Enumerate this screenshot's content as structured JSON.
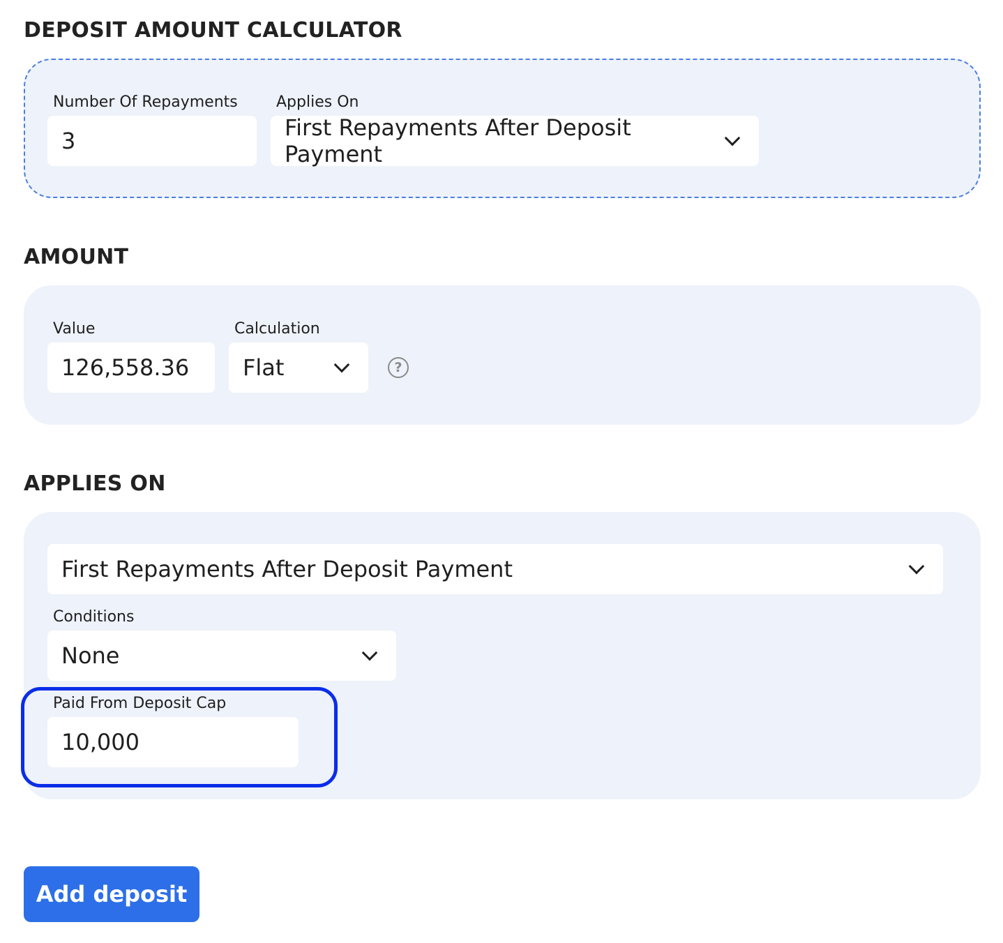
{
  "calculator": {
    "title": "DEPOSIT AMOUNT CALCULATOR",
    "repayments_label": "Number Of Repayments",
    "repayments_value": "3",
    "applies_on_label": "Applies On",
    "applies_on_value": "First Repayments After Deposit Payment"
  },
  "amount": {
    "title": "AMOUNT",
    "value_label": "Value",
    "value": "126,558.36",
    "calculation_label": "Calculation",
    "calculation_value": "Flat",
    "help_glyph": "?"
  },
  "applies_on": {
    "title": "APPLIES ON",
    "selected": "First Repayments After Deposit Payment",
    "conditions_label": "Conditions",
    "conditions_value": "None",
    "cap_label": "Paid From Deposit Cap",
    "cap_value": "10,000"
  },
  "actions": {
    "add_deposit_label": "Add deposit"
  },
  "colors": {
    "panel_bg": "#eef2fa",
    "dashed_border": "#4a7ee0",
    "highlight": "#0a2de8",
    "primary_button": "#2c6fe8"
  }
}
